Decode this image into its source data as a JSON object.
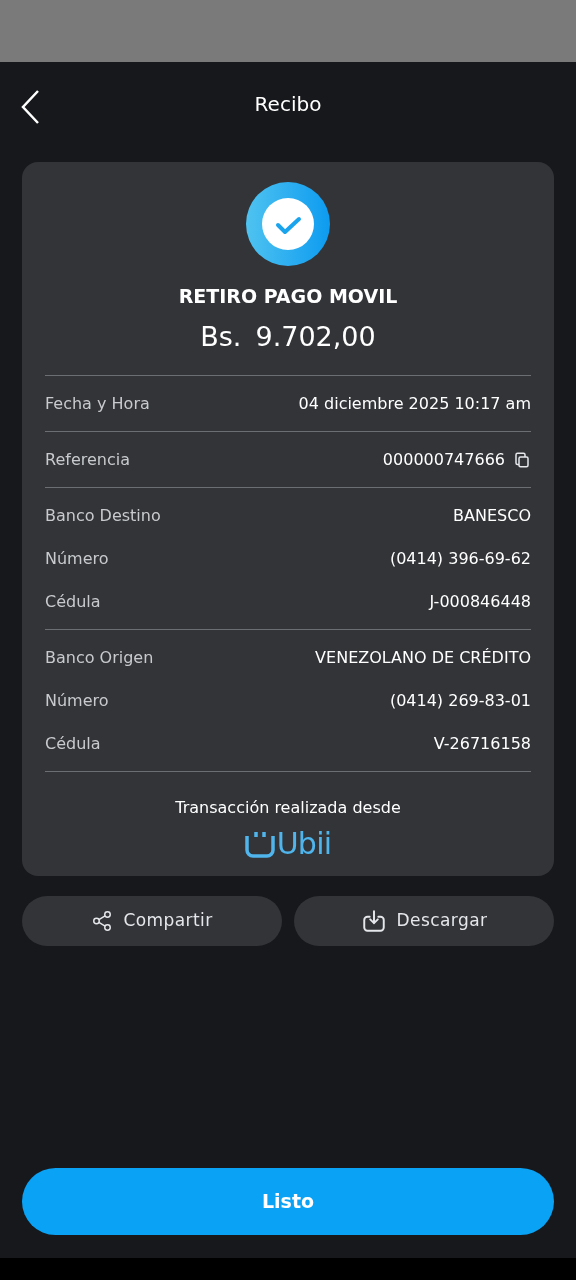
{
  "header": {
    "title": "Recibo"
  },
  "receipt": {
    "title": "RETIRO PAGO MOVIL",
    "currency": "Bs.",
    "amount": "9.702,00",
    "sections": [
      {
        "rows": [
          {
            "label": "Fecha y Hora",
            "value": "04 diciembre 2025 10:17 am",
            "kind": "text"
          }
        ]
      },
      {
        "rows": [
          {
            "label": "Referencia",
            "value": "000000747666",
            "kind": "copy"
          }
        ]
      },
      {
        "rows": [
          {
            "label": "Banco Destino",
            "value": "BANESCO",
            "kind": "text"
          },
          {
            "label": "Número",
            "value": "(0414) 396-69-62",
            "kind": "text"
          },
          {
            "label": "Cédula",
            "value": "J-000846448",
            "kind": "text"
          }
        ]
      },
      {
        "rows": [
          {
            "label": "Banco Origen",
            "value": "VENEZOLANO DE CRÉDITO",
            "kind": "text"
          },
          {
            "label": "Número",
            "value": "(0414) 269-83-01",
            "kind": "text"
          },
          {
            "label": "Cédula",
            "value": "V-26716158",
            "kind": "text"
          }
        ]
      }
    ],
    "footer": "Transacción realizada desde",
    "brand": "Ubii"
  },
  "actions": [
    {
      "label": "Compartir",
      "kind": "share"
    },
    {
      "label": "Descargar",
      "kind": "download"
    }
  ],
  "primary_button": "Listo"
}
